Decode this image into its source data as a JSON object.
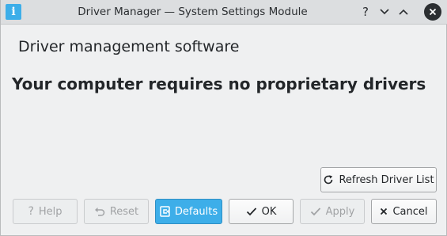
{
  "window": {
    "title": "Driver Manager — System Settings Module",
    "app_icon": "info-icon",
    "app_icon_glyph": "i",
    "controls": {
      "help_glyph": "?",
      "minimize_glyph": "⌄",
      "maximize_glyph": "⌃",
      "close_glyph": "✕"
    }
  },
  "main": {
    "heading": "Driver management software",
    "status_message": "Your computer requires no proprietary drivers",
    "refresh_button": {
      "label": "Refresh Driver List",
      "icon": "refresh-icon",
      "glyph": "↻"
    }
  },
  "footer": {
    "help": {
      "label": "Help",
      "icon": "help-icon",
      "glyph": "?",
      "enabled": false
    },
    "reset": {
      "label": "Reset",
      "icon": "undo-icon",
      "glyph": "↶",
      "enabled": false
    },
    "defaults": {
      "label": "Defaults",
      "icon": "defaults-icon",
      "glyph": "⎗",
      "enabled": true
    },
    "ok": {
      "label": "OK",
      "icon": "check-icon",
      "glyph": "✔",
      "enabled": true
    },
    "apply": {
      "label": "Apply",
      "icon": "check-icon",
      "glyph": "✔",
      "enabled": false
    },
    "cancel": {
      "label": "Cancel",
      "icon": "close-icon",
      "glyph": "✕",
      "enabled": true
    }
  },
  "colors": {
    "accent": "#3daee9",
    "window_bg": "#eff0f1",
    "titlebar_bg": "#dcdee0",
    "text": "#232629",
    "disabled_text": "#a1a3a5"
  }
}
